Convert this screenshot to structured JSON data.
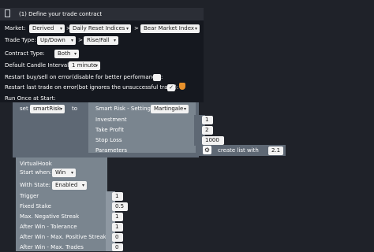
{
  "header": {
    "title": "(1) Define your trade contract"
  },
  "market": {
    "label": "Market:",
    "v1": "Derived",
    "sep1": ">",
    "v2": "Daily Reset Indices",
    "sep2": ">",
    "v3": "Bear Market Index"
  },
  "trade_type": {
    "label": "Trade Type:",
    "v1": "Up/Down",
    "sep": ">",
    "v2": "Rise/Fall"
  },
  "contract_type": {
    "label": "Contract Type:",
    "value": "Both"
  },
  "candle": {
    "label": "Default Candle Interval:",
    "value": "1 minute"
  },
  "restart_error": {
    "label": "Restart buy/sell on error",
    "note": "(disable for better performance):"
  },
  "restart_last": {
    "label": "Restart last trade on error",
    "note": "(bot ignores the unsuccessful trade):",
    "check": "✓"
  },
  "run_once": {
    "label": "Run Once at Start:"
  },
  "set_block": {
    "set_label": "set",
    "var": "smartRisk",
    "to_label": "to"
  },
  "smart_risk": {
    "title": "Smart Risk - Settings",
    "mode": "Martingale",
    "investment_label": "Investment",
    "investment": "1",
    "take_profit_label": "Take Profit",
    "take_profit": "2",
    "stop_loss_label": "Stop Loss",
    "stop_loss": "1000",
    "parameters_label": "Parameters",
    "create_list": "create list with",
    "list_value": "2.1"
  },
  "virtual_hook": {
    "title": "VirtualHook",
    "start_when_label": "Start when:",
    "start_when": "Win",
    "with_state_label": "With State:",
    "with_state": "Enabled",
    "rows": [
      {
        "label": "Trigger",
        "value": "1"
      },
      {
        "label": "Fixed Stake",
        "value": "0.5"
      },
      {
        "label": "Max. Negative Streak",
        "value": "1"
      },
      {
        "label": "After Win - Tolerance",
        "value": "1"
      },
      {
        "label": "After Win - Max. Positive Streak",
        "value": "0"
      },
      {
        "label": "After Win - Max. Trades",
        "value": "0"
      }
    ]
  }
}
